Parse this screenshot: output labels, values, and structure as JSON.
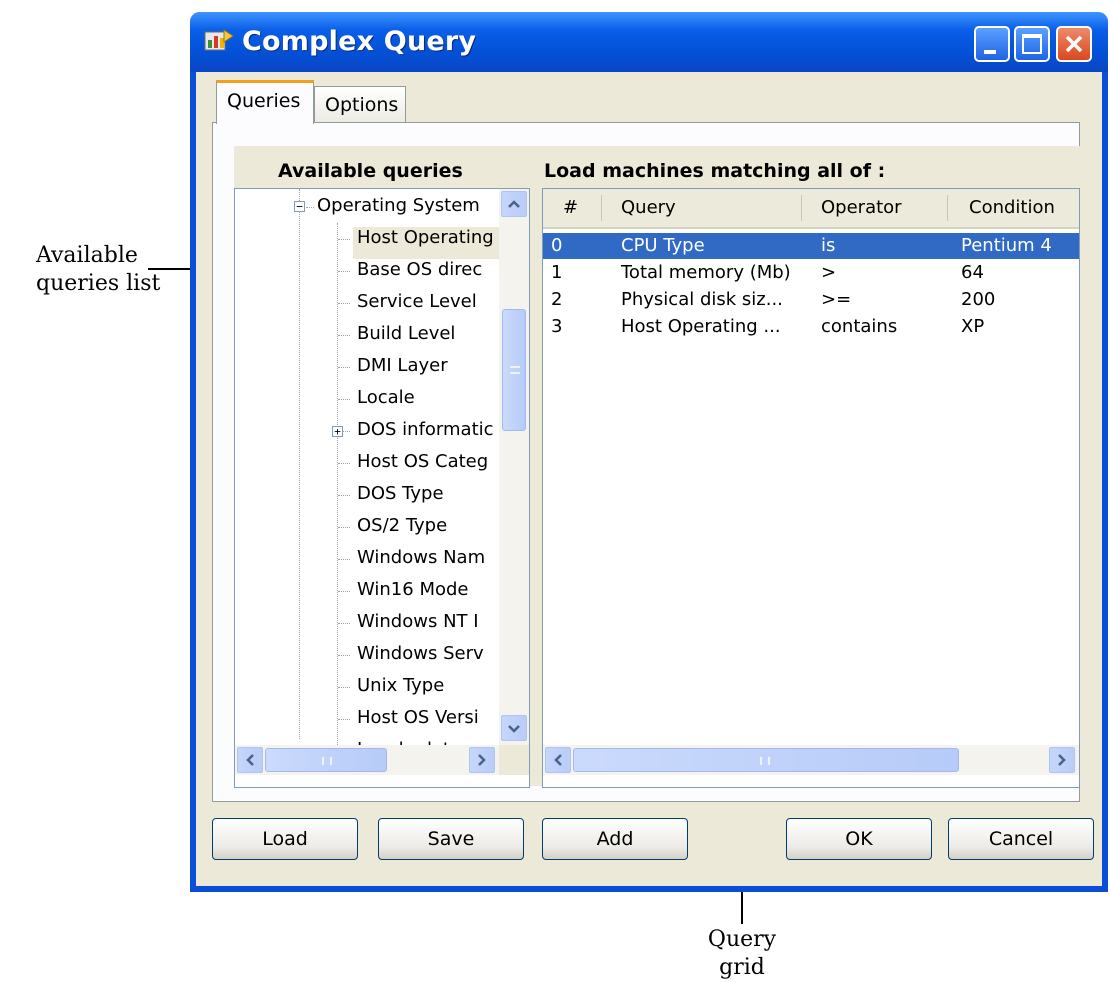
{
  "window": {
    "title": "Complex Query",
    "buttons": [
      "minimize",
      "maximize",
      "close"
    ]
  },
  "tabs": [
    {
      "label": "Queries",
      "active": true
    },
    {
      "label": "Options",
      "active": false
    }
  ],
  "available_queries": {
    "header": "Available queries",
    "root": "Operating System",
    "items": [
      {
        "label": "Host Operating",
        "selected": true
      },
      {
        "label": "Base OS direc"
      },
      {
        "label": "Service Level"
      },
      {
        "label": "Build Level"
      },
      {
        "label": "DMI Layer"
      },
      {
        "label": "Locale"
      },
      {
        "label": "DOS informatic",
        "expandable": true
      },
      {
        "label": "Host OS Categ"
      },
      {
        "label": "DOS Type"
      },
      {
        "label": "OS/2 Type"
      },
      {
        "label": "Windows Nam"
      },
      {
        "label": "Win16 Mode"
      },
      {
        "label": "Windows NT I"
      },
      {
        "label": "Windows Serv"
      },
      {
        "label": "Unix Type"
      },
      {
        "label": "Host OS Versi"
      },
      {
        "label": "Locale data",
        "expandable": true
      }
    ]
  },
  "query_grid": {
    "header": "Load machines matching all of :",
    "columns": [
      "#",
      "Query",
      "Operator",
      "Condition"
    ],
    "rows": [
      {
        "num": "0",
        "query": "CPU Type",
        "operator": "is",
        "condition": "Pentium 4",
        "selected": true
      },
      {
        "num": "1",
        "query": "Total memory (Mb)",
        "operator": ">",
        "condition": "64"
      },
      {
        "num": "2",
        "query": "Physical disk siz...",
        "operator": ">=",
        "condition": "200"
      },
      {
        "num": "3",
        "query": "Host Operating ...",
        "operator": "contains",
        "condition": "XP"
      }
    ]
  },
  "buttons": {
    "load": "Load",
    "save": "Save",
    "add": "Add",
    "ok": "OK",
    "cancel": "Cancel"
  },
  "annotations": {
    "available_queries_list": [
      "Available",
      "queries list"
    ],
    "query_grid": [
      "Query",
      "grid"
    ]
  },
  "colors": {
    "titlebar": "#0a5ee8",
    "selection": "#316ac5",
    "dialog_bg": "#ece9d8"
  }
}
